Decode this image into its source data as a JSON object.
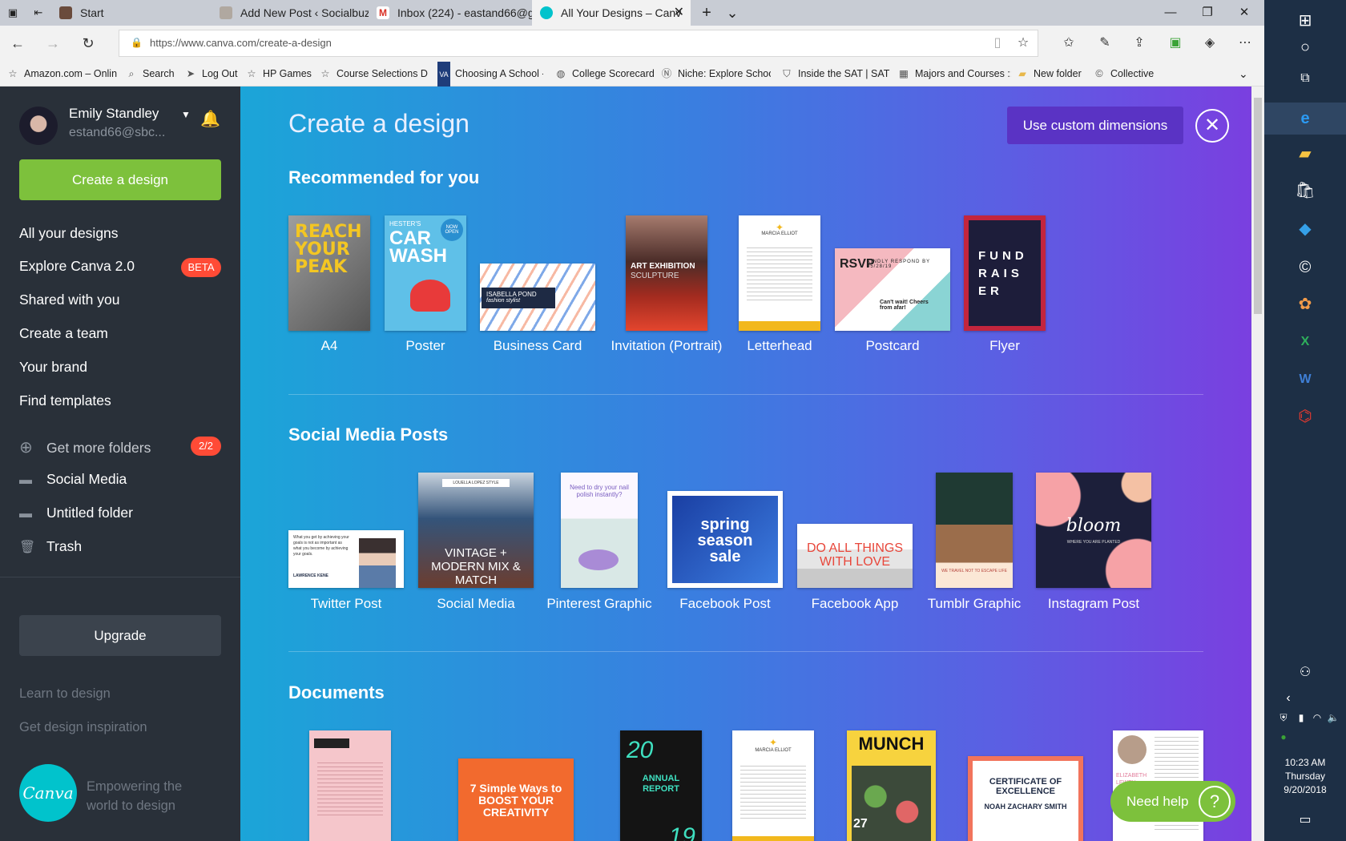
{
  "browser": {
    "tabs": [
      {
        "title": "Start",
        "color": "#6a4b3c"
      },
      {
        "title": "Add New Post ‹ Socialbuzzh",
        "color": "#b0a8a0"
      },
      {
        "title": "Inbox (224) - eastand66@g",
        "color": "#d93025"
      },
      {
        "title": "All Your Designs – Canv",
        "color": "#01c3cc"
      }
    ],
    "tab_close": "✕",
    "new_tab": "+",
    "tab_list": "⌄",
    "window_controls": {
      "minimize": "—",
      "restore": "❐",
      "close": "✕"
    },
    "url": "https://www.canva.com/create-a-design",
    "favorites": [
      "Amazon.com – Onlin",
      "Search",
      "Log Out",
      "HP Games",
      "Course Selections DH",
      "Choosing A School -",
      "College Scorecard",
      "Niche: Explore Schoo",
      "Inside the SAT | SAT S",
      "Majors and Courses ::",
      "New folder",
      "Collective"
    ]
  },
  "sidebar": {
    "user_name": "Emily Standley",
    "user_email": "estand66@sbc...",
    "create_button": "Create a design",
    "nav": [
      "All your designs",
      "Explore Canva 2.0",
      "Shared with you",
      "Create a team",
      "Your brand",
      "Find templates"
    ],
    "beta_badge": "BETA",
    "get_more_folders": "Get more folders",
    "folder_count": "2/2",
    "folders": [
      "Social Media",
      "Untitled folder",
      "Trash"
    ],
    "upgrade": "Upgrade",
    "learn": "Learn to design",
    "inspiration": "Get design inspiration",
    "logo_text": "Canva",
    "tagline": "Empowering the world to design"
  },
  "main": {
    "title": "Create a design",
    "custom_button": "Use custom dimensions",
    "close": "✕",
    "sections": {
      "recommended": "Recommended for you",
      "social": "Social Media Posts",
      "documents": "Documents"
    },
    "recommended": [
      "A4",
      "Poster",
      "Business Card",
      "Invitation (Portrait)",
      "Letterhead",
      "Postcard",
      "Flyer"
    ],
    "social": [
      "Twitter Post",
      "Social Media",
      "Pinterest Graphic",
      "Facebook Post",
      "Facebook App",
      "Tumblr Graphic",
      "Instagram Post"
    ],
    "thumb_text": {
      "a4": "REACH YOUR PEAK",
      "poster": "CAR WASH",
      "poster_top": "HESTER'S",
      "poster_badge": "NOW OPEN",
      "bizcard": "ISABELLA POND",
      "bizcard_sub": "fashion stylist",
      "invitation": "ART EXHIBITION",
      "invitation_sub": "SCULPTURE",
      "letterhead": "MARCIA ELLIOT",
      "postcard": "RSVP",
      "postcard_sub": "KINDLY RESPOND BY 05/28/19",
      "postcard_note": "Can't wait! Cheers from afar!",
      "flyer": "FUND RAIS ER",
      "twitter": "What you get by achieving your goals is not as important as what you become by achieving your goals.",
      "twitter_author": "LAWRENCE KENE",
      "socialmedia": "VINTAGE + MODERN MIX & MATCH",
      "socialmedia_top": "LOUELLA LOPEZ STYLE",
      "pinterest": "Need to dry your nail polish instantly?",
      "facebook": "spring season sale",
      "fbapp": "DO ALL THINGS WITH LOVE",
      "tumblr": "WE TRAVEL NOT TO ESCAPE LIFE",
      "instagram": "bloom",
      "instagram_sub": "WHERE YOU ARE PLANTED",
      "doc2": "7 Simple Ways to BOOST YOUR CREATIVITY",
      "doc3_top": "20",
      "doc3_mid": "ANNUAL REPORT",
      "doc3_bot": "19",
      "doc4": "MARCIA ELLIOT",
      "doc5": "MUNCH",
      "doc5_num": "27",
      "doc6": "CERTIFICATE OF EXCELLENCE",
      "doc6_name": "NOAH ZACHARY SMITH",
      "doc7": "ELIZABETH LEWEY"
    },
    "help": "Need help",
    "help_icon": "?"
  },
  "taskbar": {
    "time": "10:23 AM",
    "day": "Thursday",
    "date": "9/20/2018"
  }
}
